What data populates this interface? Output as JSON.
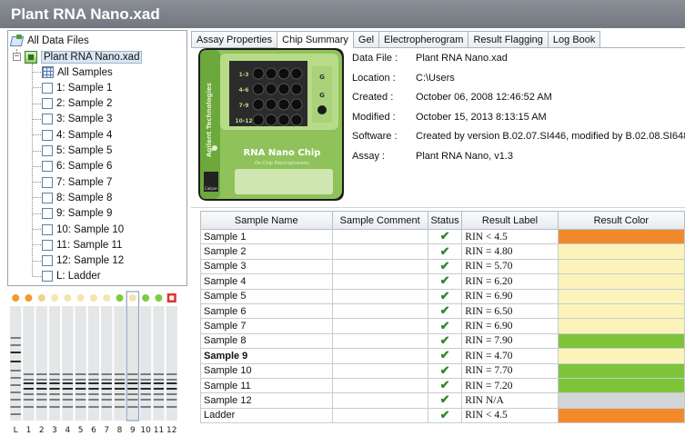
{
  "window": {
    "title": "Plant RNA Nano.xad"
  },
  "tree": {
    "root_label": "All Data Files",
    "file_label": "Plant RNA Nano.xad",
    "all_samples_label": "All Samples",
    "samples": [
      "1: Sample 1",
      "2: Sample 2",
      "3: Sample 3",
      "4: Sample 4",
      "5: Sample 5",
      "6: Sample 6",
      "7: Sample 7",
      "8: Sample 8",
      "9: Sample 9",
      "10: Sample 10",
      "11: Sample 11",
      "12: Sample 12",
      "L: Ladder"
    ],
    "selected_file_expander": "−"
  },
  "gel": {
    "lane_labels": [
      "L",
      "1",
      "2",
      "3",
      "4",
      "5",
      "6",
      "7",
      "8",
      "9",
      "10",
      "11",
      "12"
    ],
    "selected_lane": "9",
    "lane_status_colors": [
      "#f39a2e",
      "#f39a2e",
      "#f3d28a",
      "#f3e5b0",
      "#f3e5b0",
      "#f3e5b0",
      "#f3e5b0",
      "#f3e5b0",
      "#7fcc3b",
      "#f3e5b0",
      "#7fcc3b",
      "#7fcc3b",
      "#e03030"
    ]
  },
  "tabs": [
    "Assay Properties",
    "Chip Summary",
    "Gel",
    "Electropherogram",
    "Result Flagging",
    "Log Book"
  ],
  "active_tab": "Chip Summary",
  "chip": {
    "brand": "Agilent Technologies",
    "name": "RNA Nano Chip",
    "sub": "On-Chip Electrophoresis",
    "well_groups": [
      "1-3",
      "4-6",
      "7-9",
      "10-12"
    ],
    "side_labels": [
      "G",
      "G"
    ],
    "caliper": "Caliper"
  },
  "properties": [
    {
      "label": "Data File :",
      "value": "Plant RNA Nano.xad"
    },
    {
      "label": "Location :",
      "value": "C:\\Users"
    },
    {
      "label": "Created :",
      "value": "October 06, 2008 12:46:52 AM"
    },
    {
      "label": "Modified :",
      "value": "October 15, 2013 8:13:15 AM"
    },
    {
      "label": "Software :",
      "value": "Created by version B.02.07.SI446, modified by B.02.08.SI648"
    },
    {
      "label": "Assay :",
      "value": "Plant RNA Nano, v1.3"
    }
  ],
  "table": {
    "columns": [
      "Sample Name",
      "Sample Comment",
      "Status",
      "Result Label",
      "Result Color"
    ],
    "rows": [
      {
        "name": "Sample 1",
        "comment": "",
        "status": "✔",
        "label": "RIN < 4.5",
        "color": "#f28a2c",
        "bold": false
      },
      {
        "name": "Sample 2",
        "comment": "",
        "status": "✔",
        "label": "RIN = 4.80",
        "color": "#fbf3b9",
        "bold": false
      },
      {
        "name": "Sample 3",
        "comment": "",
        "status": "✔",
        "label": "RIN = 5.70",
        "color": "#fbf3b9",
        "bold": false
      },
      {
        "name": "Sample 4",
        "comment": "",
        "status": "✔",
        "label": "RIN = 6.20",
        "color": "#fbf3b9",
        "bold": false
      },
      {
        "name": "Sample 5",
        "comment": "",
        "status": "✔",
        "label": "RIN = 6.90",
        "color": "#fbf3b9",
        "bold": false
      },
      {
        "name": "Sample 6",
        "comment": "",
        "status": "✔",
        "label": "RIN = 6.50",
        "color": "#fbf3b9",
        "bold": false
      },
      {
        "name": "Sample 7",
        "comment": "",
        "status": "✔",
        "label": "RIN = 6.90",
        "color": "#fbf3b9",
        "bold": false
      },
      {
        "name": "Sample 8",
        "comment": "",
        "status": "✔",
        "label": "RIN = 7.90",
        "color": "#7ec43a",
        "bold": false
      },
      {
        "name": "Sample 9",
        "comment": "",
        "status": "✔",
        "label": "RIN = 4.70",
        "color": "#fbf3b9",
        "bold": true
      },
      {
        "name": "Sample 10",
        "comment": "",
        "status": "✔",
        "label": "RIN = 7.70",
        "color": "#7ec43a",
        "bold": false
      },
      {
        "name": "Sample 11",
        "comment": "",
        "status": "✔",
        "label": "RIN = 7.20",
        "color": "#7ec43a",
        "bold": false
      },
      {
        "name": "Sample 12",
        "comment": "",
        "status": "✔",
        "label": "RIN N/A",
        "color": "#d2d4d6",
        "bold": false
      },
      {
        "name": "Ladder",
        "comment": "",
        "status": "✔",
        "label": "RIN < 4.5",
        "color": "#f28a2c",
        "bold": false
      }
    ]
  }
}
